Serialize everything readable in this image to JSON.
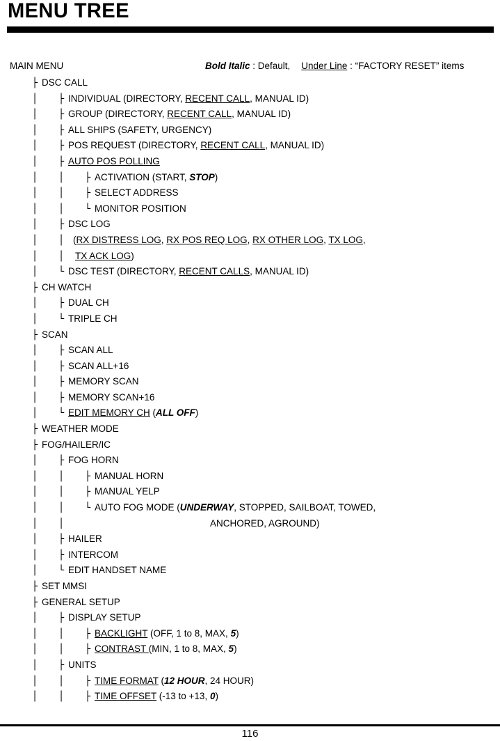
{
  "header": {
    "title": "MENU TREE",
    "main_menu_label": "MAIN MENU",
    "legend": {
      "bold_italic_term": "Bold Italic",
      "bold_italic_desc": " : Default,",
      "underline_term": "Under Line",
      "underline_desc": " : “FACTORY RESET” items"
    }
  },
  "footer": {
    "page_number": "116"
  },
  "glyphs": {
    "pipe": "│",
    "tee": "├",
    "elbow": "└"
  },
  "tree": {
    "rows": [
      {
        "guides": [],
        "conn": {
          "col": 1,
          "glyph": "tee"
        },
        "text_col": 1,
        "parts": [
          {
            "t": "DSC CALL"
          }
        ]
      },
      {
        "guides": [
          1
        ],
        "conn": {
          "col": 2,
          "glyph": "tee"
        },
        "text_col": 2,
        "parts": [
          {
            "t": "INDIVIDUAL (DIRECTORY, "
          },
          {
            "t": "RECENT CALL",
            "s": "u"
          },
          {
            "t": ", MANUAL ID)"
          }
        ]
      },
      {
        "guides": [
          1
        ],
        "conn": {
          "col": 2,
          "glyph": "tee"
        },
        "text_col": 2,
        "parts": [
          {
            "t": "GROUP (DIRECTORY, "
          },
          {
            "t": "RECENT CALL",
            "s": "u"
          },
          {
            "t": ", MANUAL ID)"
          }
        ]
      },
      {
        "guides": [
          1
        ],
        "conn": {
          "col": 2,
          "glyph": "tee"
        },
        "text_col": 2,
        "parts": [
          {
            "t": "ALL SHIPS (SAFETY, URGENCY)"
          }
        ]
      },
      {
        "guides": [
          1
        ],
        "conn": {
          "col": 2,
          "glyph": "tee"
        },
        "text_col": 2,
        "parts": [
          {
            "t": "POS REQUEST (DIRECTORY, "
          },
          {
            "t": "RECENT CALL",
            "s": "u"
          },
          {
            "t": ", MANUAL ID)"
          }
        ]
      },
      {
        "guides": [
          1
        ],
        "conn": {
          "col": 2,
          "glyph": "tee"
        },
        "text_col": 2,
        "parts": [
          {
            "t": "AUTO POS POLLING",
            "s": "u"
          }
        ]
      },
      {
        "guides": [
          1,
          2
        ],
        "conn": {
          "col": 3,
          "glyph": "tee"
        },
        "text_col": 3,
        "parts": [
          {
            "t": "ACTIVATION (START, "
          },
          {
            "t": "STOP",
            "s": "bi"
          },
          {
            "t": ")"
          }
        ]
      },
      {
        "guides": [
          1,
          2
        ],
        "conn": {
          "col": 3,
          "glyph": "tee"
        },
        "text_col": 3,
        "parts": [
          {
            "t": "SELECT ADDRESS"
          }
        ]
      },
      {
        "guides": [
          1,
          2
        ],
        "conn": {
          "col": 3,
          "glyph": "elbow"
        },
        "text_col": 3,
        "parts": [
          {
            "t": "MONITOR POSITION"
          }
        ]
      },
      {
        "guides": [
          1
        ],
        "conn": {
          "col": 2,
          "glyph": "tee"
        },
        "text_col": 2,
        "parts": [
          {
            "t": "DSC LOG"
          }
        ]
      },
      {
        "guides": [
          1,
          2
        ],
        "conn": null,
        "text_col": 2,
        "offset": 7,
        "parts": [
          {
            "t": "("
          },
          {
            "t": "RX DISTRESS LOG",
            "s": "u"
          },
          {
            "t": ", "
          },
          {
            "t": "RX POS REQ LOG",
            "s": "u"
          },
          {
            "t": ", "
          },
          {
            "t": "RX OTHER LOG",
            "s": "u"
          },
          {
            "t": ", "
          },
          {
            "t": "TX LOG",
            "s": "u"
          },
          {
            "t": ","
          }
        ]
      },
      {
        "guides": [
          1,
          2
        ],
        "conn": null,
        "text_col": 2,
        "offset": 10,
        "parts": [
          {
            "t": "TX ACK LOG",
            "s": "u"
          },
          {
            "t": ")"
          }
        ]
      },
      {
        "guides": [
          1
        ],
        "conn": {
          "col": 2,
          "glyph": "elbow"
        },
        "text_col": 2,
        "parts": [
          {
            "t": "DSC TEST (DIRECTORY, "
          },
          {
            "t": "RECENT CALLS",
            "s": "u"
          },
          {
            "t": ", MANUAL ID)"
          }
        ]
      },
      {
        "guides": [],
        "conn": {
          "col": 1,
          "glyph": "tee"
        },
        "text_col": 1,
        "parts": [
          {
            "t": "CH WATCH"
          }
        ]
      },
      {
        "guides": [
          1
        ],
        "conn": {
          "col": 2,
          "glyph": "tee"
        },
        "text_col": 2,
        "parts": [
          {
            "t": "DUAL CH"
          }
        ]
      },
      {
        "guides": [
          1
        ],
        "conn": {
          "col": 2,
          "glyph": "elbow"
        },
        "text_col": 2,
        "parts": [
          {
            "t": "TRIPLE CH"
          }
        ]
      },
      {
        "guides": [],
        "conn": {
          "col": 1,
          "glyph": "tee"
        },
        "text_col": 1,
        "parts": [
          {
            "t": "SCAN"
          }
        ]
      },
      {
        "guides": [
          1
        ],
        "conn": {
          "col": 2,
          "glyph": "tee"
        },
        "text_col": 2,
        "parts": [
          {
            "t": "SCAN ALL"
          }
        ]
      },
      {
        "guides": [
          1
        ],
        "conn": {
          "col": 2,
          "glyph": "tee"
        },
        "text_col": 2,
        "parts": [
          {
            "t": "SCAN ALL+16"
          }
        ]
      },
      {
        "guides": [
          1
        ],
        "conn": {
          "col": 2,
          "glyph": "tee"
        },
        "text_col": 2,
        "parts": [
          {
            "t": "MEMORY SCAN"
          }
        ]
      },
      {
        "guides": [
          1
        ],
        "conn": {
          "col": 2,
          "glyph": "tee"
        },
        "text_col": 2,
        "parts": [
          {
            "t": "MEMORY SCAN+16"
          }
        ]
      },
      {
        "guides": [
          1
        ],
        "conn": {
          "col": 2,
          "glyph": "elbow"
        },
        "text_col": 2,
        "parts": [
          {
            "t": "EDIT MEMORY CH",
            "s": "u"
          },
          {
            "t": " ("
          },
          {
            "t": "ALL OFF",
            "s": "bi"
          },
          {
            "t": ")"
          }
        ]
      },
      {
        "guides": [],
        "conn": {
          "col": 1,
          "glyph": "tee"
        },
        "text_col": 1,
        "parts": [
          {
            "t": "WEATHER MODE"
          }
        ]
      },
      {
        "guides": [],
        "conn": {
          "col": 1,
          "glyph": "tee"
        },
        "text_col": 1,
        "parts": [
          {
            "t": "FOG/HAILER/IC"
          }
        ]
      },
      {
        "guides": [
          1
        ],
        "conn": {
          "col": 2,
          "glyph": "tee"
        },
        "text_col": 2,
        "parts": [
          {
            "t": "FOG HORN"
          }
        ]
      },
      {
        "guides": [
          1,
          2
        ],
        "conn": {
          "col": 3,
          "glyph": "tee"
        },
        "text_col": 3,
        "parts": [
          {
            "t": "MANUAL HORN"
          }
        ]
      },
      {
        "guides": [
          1,
          2
        ],
        "conn": {
          "col": 3,
          "glyph": "tee"
        },
        "text_col": 3,
        "parts": [
          {
            "t": "MANUAL YELP"
          }
        ]
      },
      {
        "guides": [
          1,
          2
        ],
        "conn": {
          "col": 3,
          "glyph": "elbow"
        },
        "text_col": 3,
        "parts": [
          {
            "t": "AUTO FOG MODE ("
          },
          {
            "t": "UNDERWAY",
            "s": "bi"
          },
          {
            "t": ", STOPPED, SAILBOAT, TOWED,"
          }
        ]
      },
      {
        "guides": [
          1,
          2
        ],
        "conn": null,
        "text_col": 3,
        "offset": 166,
        "parts": [
          {
            "t": "ANCHORED, AGROUND)"
          }
        ]
      },
      {
        "guides": [
          1
        ],
        "conn": {
          "col": 2,
          "glyph": "tee"
        },
        "text_col": 2,
        "parts": [
          {
            "t": "HAILER"
          }
        ]
      },
      {
        "guides": [
          1
        ],
        "conn": {
          "col": 2,
          "glyph": "tee"
        },
        "text_col": 2,
        "parts": [
          {
            "t": "INTERCOM"
          }
        ]
      },
      {
        "guides": [
          1
        ],
        "conn": {
          "col": 2,
          "glyph": "elbow"
        },
        "text_col": 2,
        "parts": [
          {
            "t": "EDIT HANDSET NAME"
          }
        ]
      },
      {
        "guides": [],
        "conn": {
          "col": 1,
          "glyph": "tee"
        },
        "text_col": 1,
        "parts": [
          {
            "t": "SET MMSI"
          }
        ]
      },
      {
        "guides": [],
        "conn": {
          "col": 1,
          "glyph": "tee"
        },
        "text_col": 1,
        "parts": [
          {
            "t": "GENERAL SETUP"
          }
        ]
      },
      {
        "guides": [
          1
        ],
        "conn": {
          "col": 2,
          "glyph": "tee"
        },
        "text_col": 2,
        "parts": [
          {
            "t": "DISPLAY SETUP"
          }
        ]
      },
      {
        "guides": [
          1,
          2
        ],
        "conn": {
          "col": 3,
          "glyph": "tee"
        },
        "text_col": 3,
        "parts": [
          {
            "t": "BACKLIGHT",
            "s": "u"
          },
          {
            "t": " (OFF, 1 to 8, MAX, "
          },
          {
            "t": "5",
            "s": "bi"
          },
          {
            "t": ")"
          }
        ]
      },
      {
        "guides": [
          1,
          2
        ],
        "conn": {
          "col": 3,
          "glyph": "tee"
        },
        "text_col": 3,
        "parts": [
          {
            "t": "CONTRAST ",
            "s": "u"
          },
          {
            "t": "(MIN, 1 to 8, MAX, "
          },
          {
            "t": "5",
            "s": "bi"
          },
          {
            "t": ")"
          }
        ]
      },
      {
        "guides": [
          1
        ],
        "conn": {
          "col": 2,
          "glyph": "tee"
        },
        "text_col": 2,
        "parts": [
          {
            "t": "UNITS"
          }
        ]
      },
      {
        "guides": [
          1,
          2
        ],
        "conn": {
          "col": 3,
          "glyph": "tee"
        },
        "text_col": 3,
        "parts": [
          {
            "t": "TIME FORMAT",
            "s": "u"
          },
          {
            "t": " ("
          },
          {
            "t": "12 HOUR",
            "s": "bi"
          },
          {
            "t": ", 24 HOUR)"
          }
        ]
      },
      {
        "guides": [
          1,
          2
        ],
        "conn": {
          "col": 3,
          "glyph": "tee"
        },
        "text_col": 3,
        "parts": [
          {
            "t": "TIME OFFSET",
            "s": "u"
          },
          {
            "t": " (-13 to +13, "
          },
          {
            "t": "0",
            "s": "bi"
          },
          {
            "t": ")"
          }
        ]
      }
    ]
  }
}
